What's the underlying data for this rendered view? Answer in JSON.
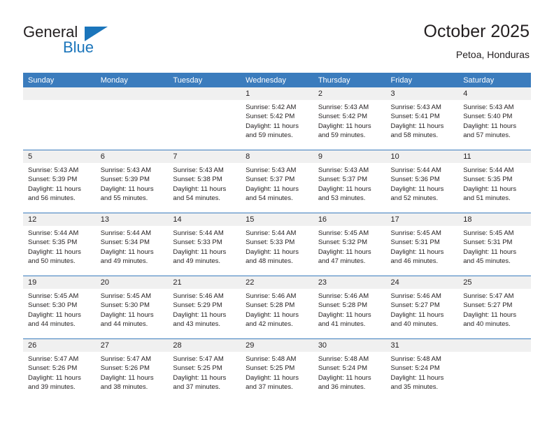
{
  "brand": {
    "name_top": "General",
    "name_bottom": "Blue",
    "triangle_icon": "triangle-icon",
    "accent_color": "#1b75bb"
  },
  "header": {
    "title": "October 2025",
    "subtitle": "Petoa, Honduras"
  },
  "theme": {
    "header_row_bg": "#3b7cbd",
    "daynum_band_bg": "#f0f0f0",
    "row_divider": "#3b7cbd",
    "text": "#231f20"
  },
  "calendar": {
    "weekday_headers": [
      "Sunday",
      "Monday",
      "Tuesday",
      "Wednesday",
      "Thursday",
      "Friday",
      "Saturday"
    ],
    "weeks": [
      [
        {
          "day": "",
          "empty": true
        },
        {
          "day": "",
          "empty": true
        },
        {
          "day": "",
          "empty": true
        },
        {
          "day": "1",
          "sunrise": "Sunrise: 5:42 AM",
          "sunset": "Sunset: 5:42 PM",
          "daylight_1": "Daylight: 11 hours",
          "daylight_2": "and 59 minutes."
        },
        {
          "day": "2",
          "sunrise": "Sunrise: 5:43 AM",
          "sunset": "Sunset: 5:42 PM",
          "daylight_1": "Daylight: 11 hours",
          "daylight_2": "and 59 minutes."
        },
        {
          "day": "3",
          "sunrise": "Sunrise: 5:43 AM",
          "sunset": "Sunset: 5:41 PM",
          "daylight_1": "Daylight: 11 hours",
          "daylight_2": "and 58 minutes."
        },
        {
          "day": "4",
          "sunrise": "Sunrise: 5:43 AM",
          "sunset": "Sunset: 5:40 PM",
          "daylight_1": "Daylight: 11 hours",
          "daylight_2": "and 57 minutes."
        }
      ],
      [
        {
          "day": "5",
          "sunrise": "Sunrise: 5:43 AM",
          "sunset": "Sunset: 5:39 PM",
          "daylight_1": "Daylight: 11 hours",
          "daylight_2": "and 56 minutes."
        },
        {
          "day": "6",
          "sunrise": "Sunrise: 5:43 AM",
          "sunset": "Sunset: 5:39 PM",
          "daylight_1": "Daylight: 11 hours",
          "daylight_2": "and 55 minutes."
        },
        {
          "day": "7",
          "sunrise": "Sunrise: 5:43 AM",
          "sunset": "Sunset: 5:38 PM",
          "daylight_1": "Daylight: 11 hours",
          "daylight_2": "and 54 minutes."
        },
        {
          "day": "8",
          "sunrise": "Sunrise: 5:43 AM",
          "sunset": "Sunset: 5:37 PM",
          "daylight_1": "Daylight: 11 hours",
          "daylight_2": "and 54 minutes."
        },
        {
          "day": "9",
          "sunrise": "Sunrise: 5:43 AM",
          "sunset": "Sunset: 5:37 PM",
          "daylight_1": "Daylight: 11 hours",
          "daylight_2": "and 53 minutes."
        },
        {
          "day": "10",
          "sunrise": "Sunrise: 5:44 AM",
          "sunset": "Sunset: 5:36 PM",
          "daylight_1": "Daylight: 11 hours",
          "daylight_2": "and 52 minutes."
        },
        {
          "day": "11",
          "sunrise": "Sunrise: 5:44 AM",
          "sunset": "Sunset: 5:35 PM",
          "daylight_1": "Daylight: 11 hours",
          "daylight_2": "and 51 minutes."
        }
      ],
      [
        {
          "day": "12",
          "sunrise": "Sunrise: 5:44 AM",
          "sunset": "Sunset: 5:35 PM",
          "daylight_1": "Daylight: 11 hours",
          "daylight_2": "and 50 minutes."
        },
        {
          "day": "13",
          "sunrise": "Sunrise: 5:44 AM",
          "sunset": "Sunset: 5:34 PM",
          "daylight_1": "Daylight: 11 hours",
          "daylight_2": "and 49 minutes."
        },
        {
          "day": "14",
          "sunrise": "Sunrise: 5:44 AM",
          "sunset": "Sunset: 5:33 PM",
          "daylight_1": "Daylight: 11 hours",
          "daylight_2": "and 49 minutes."
        },
        {
          "day": "15",
          "sunrise": "Sunrise: 5:44 AM",
          "sunset": "Sunset: 5:33 PM",
          "daylight_1": "Daylight: 11 hours",
          "daylight_2": "and 48 minutes."
        },
        {
          "day": "16",
          "sunrise": "Sunrise: 5:45 AM",
          "sunset": "Sunset: 5:32 PM",
          "daylight_1": "Daylight: 11 hours",
          "daylight_2": "and 47 minutes."
        },
        {
          "day": "17",
          "sunrise": "Sunrise: 5:45 AM",
          "sunset": "Sunset: 5:31 PM",
          "daylight_1": "Daylight: 11 hours",
          "daylight_2": "and 46 minutes."
        },
        {
          "day": "18",
          "sunrise": "Sunrise: 5:45 AM",
          "sunset": "Sunset: 5:31 PM",
          "daylight_1": "Daylight: 11 hours",
          "daylight_2": "and 45 minutes."
        }
      ],
      [
        {
          "day": "19",
          "sunrise": "Sunrise: 5:45 AM",
          "sunset": "Sunset: 5:30 PM",
          "daylight_1": "Daylight: 11 hours",
          "daylight_2": "and 44 minutes."
        },
        {
          "day": "20",
          "sunrise": "Sunrise: 5:45 AM",
          "sunset": "Sunset: 5:30 PM",
          "daylight_1": "Daylight: 11 hours",
          "daylight_2": "and 44 minutes."
        },
        {
          "day": "21",
          "sunrise": "Sunrise: 5:46 AM",
          "sunset": "Sunset: 5:29 PM",
          "daylight_1": "Daylight: 11 hours",
          "daylight_2": "and 43 minutes."
        },
        {
          "day": "22",
          "sunrise": "Sunrise: 5:46 AM",
          "sunset": "Sunset: 5:28 PM",
          "daylight_1": "Daylight: 11 hours",
          "daylight_2": "and 42 minutes."
        },
        {
          "day": "23",
          "sunrise": "Sunrise: 5:46 AM",
          "sunset": "Sunset: 5:28 PM",
          "daylight_1": "Daylight: 11 hours",
          "daylight_2": "and 41 minutes."
        },
        {
          "day": "24",
          "sunrise": "Sunrise: 5:46 AM",
          "sunset": "Sunset: 5:27 PM",
          "daylight_1": "Daylight: 11 hours",
          "daylight_2": "and 40 minutes."
        },
        {
          "day": "25",
          "sunrise": "Sunrise: 5:47 AM",
          "sunset": "Sunset: 5:27 PM",
          "daylight_1": "Daylight: 11 hours",
          "daylight_2": "and 40 minutes."
        }
      ],
      [
        {
          "day": "26",
          "sunrise": "Sunrise: 5:47 AM",
          "sunset": "Sunset: 5:26 PM",
          "daylight_1": "Daylight: 11 hours",
          "daylight_2": "and 39 minutes."
        },
        {
          "day": "27",
          "sunrise": "Sunrise: 5:47 AM",
          "sunset": "Sunset: 5:26 PM",
          "daylight_1": "Daylight: 11 hours",
          "daylight_2": "and 38 minutes."
        },
        {
          "day": "28",
          "sunrise": "Sunrise: 5:47 AM",
          "sunset": "Sunset: 5:25 PM",
          "daylight_1": "Daylight: 11 hours",
          "daylight_2": "and 37 minutes."
        },
        {
          "day": "29",
          "sunrise": "Sunrise: 5:48 AM",
          "sunset": "Sunset: 5:25 PM",
          "daylight_1": "Daylight: 11 hours",
          "daylight_2": "and 37 minutes."
        },
        {
          "day": "30",
          "sunrise": "Sunrise: 5:48 AM",
          "sunset": "Sunset: 5:24 PM",
          "daylight_1": "Daylight: 11 hours",
          "daylight_2": "and 36 minutes."
        },
        {
          "day": "31",
          "sunrise": "Sunrise: 5:48 AM",
          "sunset": "Sunset: 5:24 PM",
          "daylight_1": "Daylight: 11 hours",
          "daylight_2": "and 35 minutes."
        },
        {
          "day": "",
          "empty": true
        }
      ]
    ]
  }
}
